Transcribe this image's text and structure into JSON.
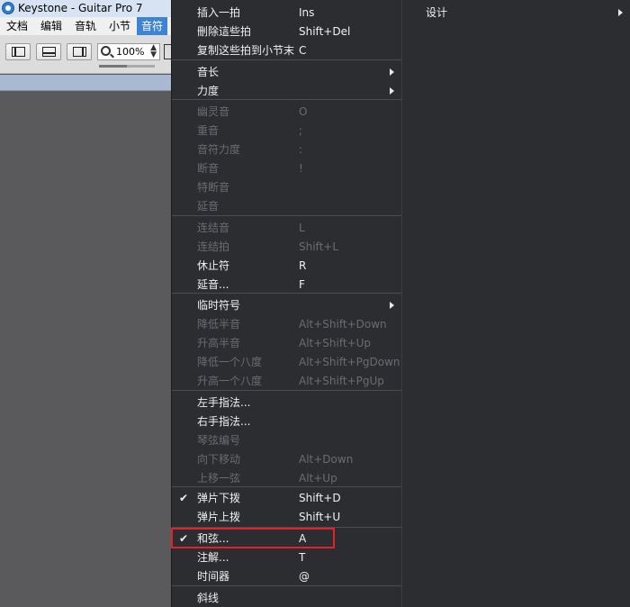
{
  "window": {
    "title": "Keystone - Guitar Pro 7"
  },
  "menubar": {
    "items": [
      {
        "label": "文档"
      },
      {
        "label": "编辑"
      },
      {
        "label": "音轨"
      },
      {
        "label": "小节"
      },
      {
        "label": "音符"
      }
    ],
    "active": "音符"
  },
  "toolbar": {
    "zoom_value": "100%"
  },
  "note_menu": {
    "items": [
      {
        "label": "插入一拍",
        "shortcut": "Ins",
        "enabled": true
      },
      {
        "label": "刪除這些拍",
        "shortcut": "Shift+Del",
        "enabled": true
      },
      {
        "label": "复制这些拍到小节末",
        "shortcut": "C",
        "enabled": true
      },
      {
        "label": "音长",
        "shortcut": "",
        "enabled": true,
        "submenu": true
      },
      {
        "label": "力度",
        "shortcut": "",
        "enabled": true,
        "submenu": true
      },
      {
        "label": "幽灵音",
        "shortcut": "O",
        "enabled": false
      },
      {
        "label": "重音",
        "shortcut": ";",
        "enabled": false
      },
      {
        "label": "音符力度",
        "shortcut": ":",
        "enabled": false
      },
      {
        "label": "断音",
        "shortcut": "!",
        "enabled": false
      },
      {
        "label": "特断音",
        "shortcut": "",
        "enabled": false
      },
      {
        "label": "延音",
        "shortcut": "",
        "enabled": false
      },
      {
        "label": "连结音",
        "shortcut": "L",
        "enabled": false
      },
      {
        "label": "连结拍",
        "shortcut": "Shift+L",
        "enabled": false
      },
      {
        "label": "休止符",
        "shortcut": "R",
        "enabled": true
      },
      {
        "label": "延音...",
        "shortcut": "F",
        "enabled": true
      },
      {
        "label": "临时符号",
        "shortcut": "",
        "enabled": true,
        "submenu": true
      },
      {
        "label": "降低半音",
        "shortcut": "Alt+Shift+Down",
        "enabled": false
      },
      {
        "label": "升高半音",
        "shortcut": "Alt+Shift+Up",
        "enabled": false
      },
      {
        "label": "降低一个八度",
        "shortcut": "Alt+Shift+PgDown",
        "enabled": false
      },
      {
        "label": "升高一个八度",
        "shortcut": "Alt+Shift+PgUp",
        "enabled": false
      },
      {
        "label": "左手指法...",
        "shortcut": "",
        "enabled": true
      },
      {
        "label": "右手指法...",
        "shortcut": "",
        "enabled": true
      },
      {
        "label": "琴弦编号",
        "shortcut": "",
        "enabled": false
      },
      {
        "label": "向下移动",
        "shortcut": "Alt+Down",
        "enabled": false
      },
      {
        "label": "上移一弦",
        "shortcut": "Alt+Up",
        "enabled": false
      },
      {
        "label": "弹片下拨",
        "shortcut": "Shift+D",
        "enabled": true,
        "checked": true
      },
      {
        "label": "弹片上拨",
        "shortcut": "Shift+U",
        "enabled": true
      },
      {
        "label": "和弦...",
        "shortcut": "A",
        "enabled": true,
        "checked": true
      },
      {
        "label": "注解...",
        "shortcut": "T",
        "enabled": true
      },
      {
        "label": "时间器",
        "shortcut": "@",
        "enabled": true
      },
      {
        "label": "斜线",
        "shortcut": "",
        "enabled": true
      }
    ]
  },
  "sub_menu": {
    "items": [
      {
        "label": "设计",
        "submenu": true
      }
    ]
  },
  "colors": {
    "menu_bg": "#2b2d31",
    "menu_text": "#f1f1f1",
    "disabled_text": "#6a6c71",
    "highlight_border": "#e3212d",
    "active_menu": "#3e83d6"
  }
}
